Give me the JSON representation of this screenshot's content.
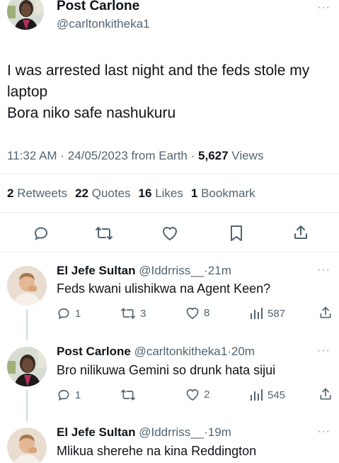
{
  "main_tweet": {
    "display_name": "Post Carlone",
    "handle": "@carltonkitheka1",
    "text_line1": "I was arrested last night and the feds stole my",
    "text_line2": "laptop",
    "text_line3": "Bora niko safe nashukuru",
    "time": "11:32 AM",
    "date": "24/05/2023",
    "source": "from Earth",
    "views_count": "5,627",
    "views_label": "Views",
    "retweets_count": "2",
    "retweets_label": "Retweets",
    "quotes_count": "22",
    "quotes_label": "Quotes",
    "likes_count": "16",
    "likes_label": "Likes",
    "bookmarks_count": "1",
    "bookmarks_label": "Bookmark",
    "more": "···"
  },
  "replies": [
    {
      "display_name": "El Jefe Sultan",
      "handle": "@Iddrriss__",
      "time": "·21m",
      "text": "Feds kwani ulishikwa na Agent Keen?",
      "replies": "1",
      "retweets": "3",
      "likes": "8",
      "views": "587",
      "more": "···"
    },
    {
      "display_name": "Post Carlone",
      "handle": "@carltonkitheka1",
      "time": "·20m",
      "text": "Bro nilikuwa Gemini so drunk hata sijui",
      "replies": "1",
      "retweets": "",
      "likes": "2",
      "views": "545",
      "more": "···"
    },
    {
      "display_name": "El Jefe Sultan",
      "handle": "@Iddrriss__",
      "time": "·19m",
      "text": "Mlikua sherehe na kina Reddington",
      "more": "···"
    }
  ],
  "colors": {
    "text": "#0f1419",
    "muted": "#536471",
    "divider": "#e6ecf0",
    "action_blue": "#1d9bf0"
  },
  "icons": [
    "reply-icon",
    "retweet-icon",
    "like-icon",
    "bookmark-icon",
    "share-icon",
    "views-icon",
    "more-icon"
  ]
}
